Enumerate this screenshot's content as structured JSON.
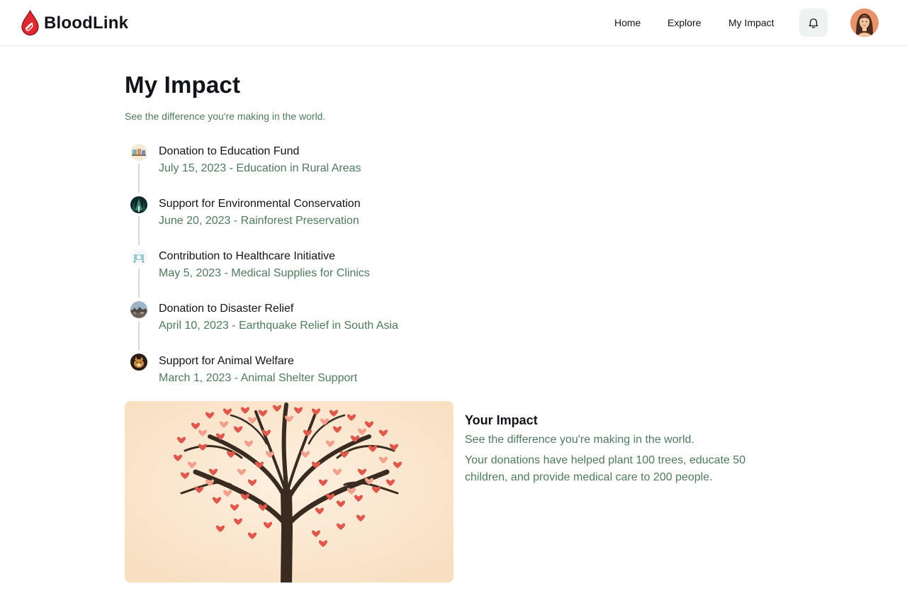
{
  "header": {
    "brand": "BloodLink",
    "nav": [
      {
        "label": "Home"
      },
      {
        "label": "Explore"
      },
      {
        "label": "My Impact"
      }
    ],
    "icons": {
      "logo": "blood-drop-icon",
      "notifications": "bell-icon",
      "avatar": "user-avatar"
    }
  },
  "main": {
    "title": "My Impact",
    "subtitle": "See the difference you're making in the world.",
    "timeline": [
      {
        "title": "Donation to Education Fund",
        "subtitle": "July 15, 2023 - Education in Rural Areas",
        "icon": "education-thumbnail"
      },
      {
        "title": "Support for Environmental Conservation",
        "subtitle": "June 20, 2023 - Rainforest Preservation",
        "icon": "forest-thumbnail"
      },
      {
        "title": "Contribution to Healthcare Initiative",
        "subtitle": "May 5, 2023 - Medical Supplies for Clinics",
        "icon": "healthcare-thumbnail"
      },
      {
        "title": "Donation to Disaster Relief",
        "subtitle": "April 10, 2023 - Earthquake Relief in South Asia",
        "icon": "disaster-thumbnail"
      },
      {
        "title": "Support for Animal Welfare",
        "subtitle": "March 1, 2023 - Animal Shelter Support",
        "icon": "animal-thumbnail"
      }
    ],
    "impact": {
      "title": "Your Impact",
      "subtitle": "See the difference you're making in the world.",
      "body": "Your donations have helped plant 100 trees, educate 50 children, and provide medical care to 200 people.",
      "image": "heart-tree-illustration"
    }
  },
  "colors": {
    "accent_green": "#4f7a5e",
    "brand_red": "#e0282e",
    "text": "#111418"
  }
}
